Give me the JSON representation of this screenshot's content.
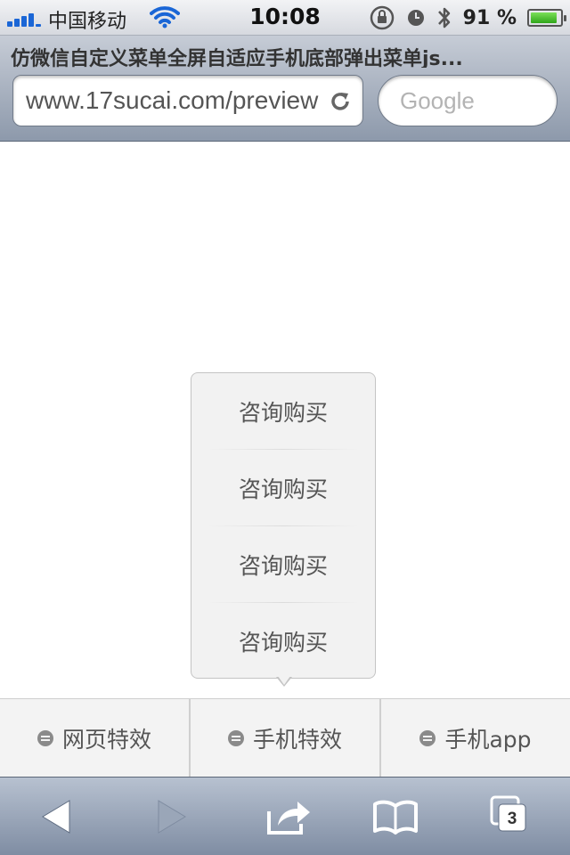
{
  "status_bar": {
    "carrier": "中国移动",
    "time": "10:08",
    "battery_percent": "91 %",
    "battery_level": 0.91
  },
  "browser": {
    "page_title": "仿微信自定义菜单全屏自适应手机底部弹出菜单js...",
    "url": "www.17sucai.com/preview",
    "search_placeholder": "Google"
  },
  "popup_menu": {
    "items": [
      "咨询购买",
      "咨询购买",
      "咨询购买",
      "咨询购买"
    ]
  },
  "bottom_menu": {
    "items": [
      "网页特效",
      "手机特效",
      "手机app"
    ]
  },
  "toolbar": {
    "tab_count": "3"
  },
  "colors": {
    "signal": "#1a66d6",
    "battery": "#2fa61a",
    "menu_text": "#555555"
  }
}
